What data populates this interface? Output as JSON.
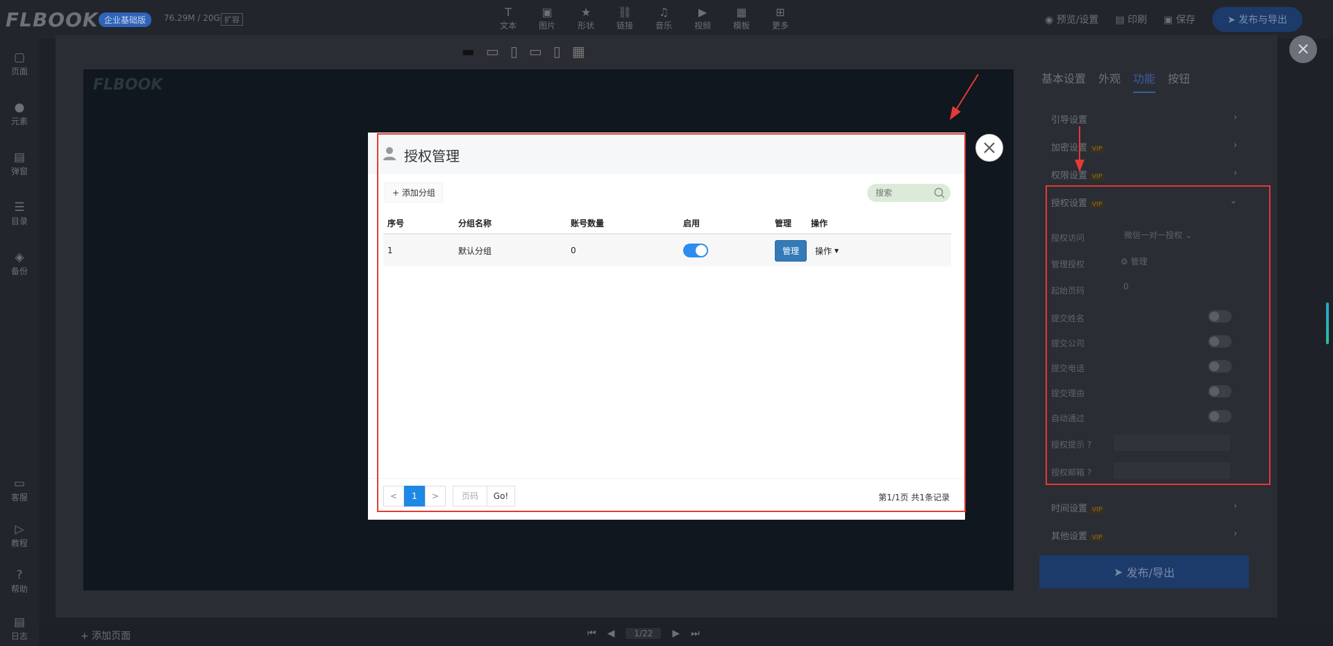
{
  "topbar": {
    "logo": "FLBOOK",
    "edition": "企业基础版",
    "storage": "76.29M / 20G",
    "storage_tag": "扩容",
    "tools": [
      {
        "label": "文本",
        "icon": "text-icon"
      },
      {
        "label": "图片",
        "icon": "image-icon"
      },
      {
        "label": "形状",
        "icon": "star-icon"
      },
      {
        "label": "链接",
        "icon": "link-icon"
      },
      {
        "label": "音乐",
        "icon": "music-icon"
      },
      {
        "label": "视频",
        "icon": "video-icon"
      },
      {
        "label": "模板",
        "icon": "template-icon"
      },
      {
        "label": "更多",
        "icon": "more-icon"
      }
    ],
    "preview": "预览/设置",
    "print": "印刷",
    "save": "保存",
    "publish": "发布与导出"
  },
  "leftbar": {
    "items": [
      {
        "label": "页面",
        "icon": "page-icon"
      },
      {
        "label": "元素",
        "icon": "element-icon"
      },
      {
        "label": "弹窗",
        "icon": "popup-icon"
      },
      {
        "label": "目录",
        "icon": "list-icon"
      },
      {
        "label": "备份",
        "icon": "layers-icon"
      },
      {
        "label": "客服",
        "icon": "chat-icon"
      },
      {
        "label": "教程",
        "icon": "play-icon"
      },
      {
        "label": "帮助",
        "icon": "help-icon"
      },
      {
        "label": "日志",
        "icon": "log-icon"
      }
    ]
  },
  "bottombar": {
    "add_page": "+ 添加页面",
    "page": "1/22"
  },
  "editor": {
    "preview_logo": "FLBOOK",
    "tabs": [
      "基本设置",
      "外观",
      "功能",
      "按钮"
    ],
    "active_tab": 2,
    "sections": [
      {
        "label": "引导设置",
        "pro": false
      },
      {
        "label": "加密设置",
        "pro": true
      },
      {
        "label": "权限设置",
        "pro": true
      },
      {
        "label": "授权设置",
        "pro": true
      }
    ],
    "auth": {
      "access_label": "授权访问",
      "access_value": "微信一对一授权",
      "manage_label": "管理授权",
      "manage_button": "管理",
      "start_page_label": "起始页码",
      "start_page_value": "0",
      "toggles": [
        "提交姓名",
        "提交公司",
        "提交电话",
        "提交理由",
        "自动通过"
      ],
      "tip_label": "授权提示",
      "email_label": "授权邮箱"
    },
    "more_sections": [
      {
        "label": "时间设置",
        "pro": true
      },
      {
        "label": "其他设置",
        "pro": true
      }
    ],
    "publish": "发布/导出"
  },
  "dialog": {
    "title": "授权管理",
    "add_group": "+ 添加分组",
    "search_placeholder": "搜索",
    "columns": [
      "序号",
      "分组名称",
      "账号数量",
      "启用",
      "管理",
      "操作"
    ],
    "rows": [
      {
        "index": "1",
        "name": "默认分组",
        "count": "0",
        "enabled": true,
        "manage": "管理",
        "op": "操作"
      }
    ],
    "pager": {
      "prev": "<",
      "current": "1",
      "next": ">",
      "page_placeholder": "页码",
      "go": "Go!",
      "summary": "第1/1页 共1条记录"
    }
  },
  "colors": {
    "accent": "#1e88e5",
    "annotation": "#e53935",
    "switch_on": "#2d8cf0",
    "manage_button": "#337ab7"
  }
}
